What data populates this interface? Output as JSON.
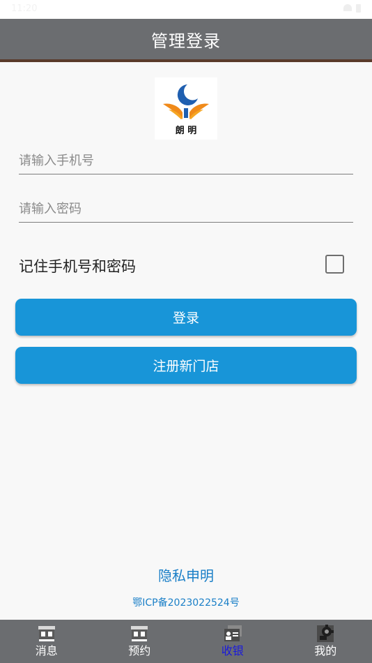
{
  "status_bar": {
    "time": "11:20"
  },
  "header": {
    "title": "管理登录"
  },
  "logo": {
    "text": "朗 明"
  },
  "form": {
    "phone_placeholder": "请输入手机号",
    "password_placeholder": "请输入密码",
    "remember_label": "记住手机号和密码",
    "remember_checked": false
  },
  "buttons": {
    "login_label": "登录",
    "register_label": "注册新门店"
  },
  "footer": {
    "privacy_label": "隐私申明",
    "icp_text": "鄂ICP备2023022524号"
  },
  "tabs": [
    {
      "label": "消息",
      "icon": "store-icon",
      "active": false
    },
    {
      "label": "预约",
      "icon": "store-icon",
      "active": false
    },
    {
      "label": "收银",
      "icon": "id-card-icon",
      "active": true
    },
    {
      "label": "我的",
      "icon": "gear-icon",
      "active": false
    }
  ],
  "colors": {
    "header_bg": "#6b6d70",
    "accent_button": "#1895d8",
    "link": "#1a7fc7",
    "active_tab": "#1a1adc"
  }
}
